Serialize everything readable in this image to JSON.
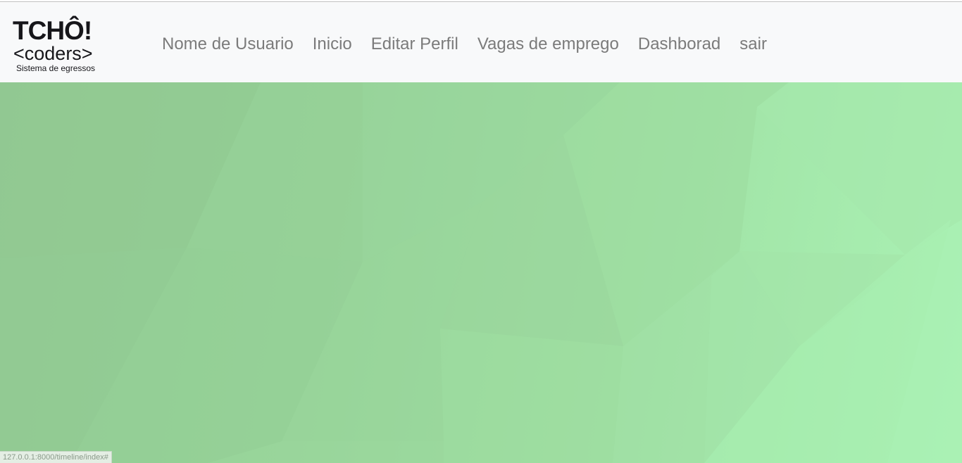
{
  "logo": {
    "line1": "TCHÔ!",
    "line2": "<coders>",
    "line3": "Sistema de egressos"
  },
  "nav": {
    "items": [
      {
        "label": "Nome de Usuario"
      },
      {
        "label": "Inicio"
      },
      {
        "label": "Editar Perfil"
      },
      {
        "label": "Vagas de emprego"
      },
      {
        "label": "Dashborad"
      },
      {
        "label": "sair"
      }
    ]
  },
  "status_bar": {
    "url": "127.0.0.1:8000/timeline/index#"
  },
  "colors": {
    "navbar_bg": "#f8f9fa",
    "nav_link": "#7b7b7b",
    "hero_green_dark": "#93cb94",
    "hero_green_light": "#aaf2b4"
  }
}
